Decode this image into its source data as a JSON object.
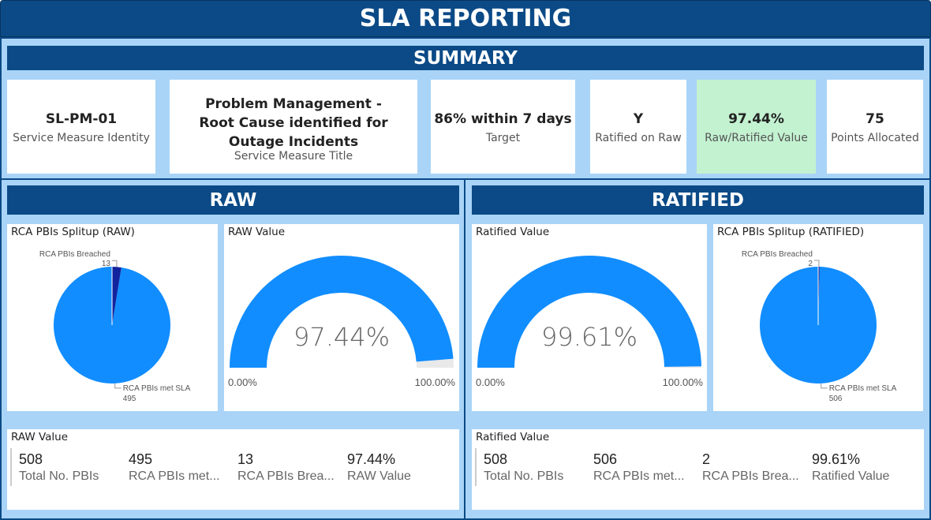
{
  "header": {
    "title": "SLA REPORTING"
  },
  "summary": {
    "heading": "SUMMARY",
    "cards": [
      {
        "value": "SL-PM-01",
        "label": "Service Measure Identity"
      },
      {
        "value": "Problem Management - Root Cause identified for Outage Incidents",
        "label": "Service Measure Title"
      },
      {
        "value": "86% within 7 days",
        "label": "Target"
      },
      {
        "value": "Y",
        "label": "Ratified on Raw"
      },
      {
        "value": "97.44%",
        "label": "Raw/Ratified Value"
      },
      {
        "value": "75",
        "label": "Points Allocated"
      }
    ]
  },
  "colors": {
    "brand": "#0b4a86",
    "frame": "#a9d4f7",
    "pie_main": "#118dff",
    "pie_breach": "#12239e",
    "gauge_bg": "#e9e9e9",
    "highlight": "#c3f2d1"
  },
  "raw": {
    "heading": "RAW",
    "pie_title": "RCA PBIs Splitup (RAW)",
    "gauge_title": "RAW Value",
    "gauge_value": "97.44%",
    "gauge_min": "0.00%",
    "gauge_max": "100.00%",
    "stats_title": "RAW Value",
    "stats": [
      {
        "value": "508",
        "label": "Total No. PBIs"
      },
      {
        "value": "495",
        "label": "RCA PBIs met..."
      },
      {
        "value": "13",
        "label": "RCA PBIs Brea..."
      },
      {
        "value": "97.44%",
        "label": "RAW Value"
      }
    ]
  },
  "ratified": {
    "heading": "RATIFIED",
    "pie_title": "RCA PBIs Splitup (RATIFIED)",
    "gauge_title": "Ratified Value",
    "gauge_value": "99.61%",
    "gauge_min": "0.00%",
    "gauge_max": "100.00%",
    "stats_title": "Ratified Value",
    "stats": [
      {
        "value": "508",
        "label": "Total No. PBIs"
      },
      {
        "value": "506",
        "label": "RCA PBIs met..."
      },
      {
        "value": "2",
        "label": "RCA PBIs Brea..."
      },
      {
        "value": "99.61%",
        "label": "Ratified Value"
      }
    ]
  },
  "chart_data": [
    {
      "type": "pie",
      "title": "RCA PBIs Splitup (RAW)",
      "categories": [
        "RCA PBIs met SLA",
        "RCA PBIs Breached"
      ],
      "values": [
        495,
        13
      ]
    },
    {
      "type": "gauge",
      "title": "RAW Value",
      "value": 97.44,
      "min": 0,
      "max": 100
    },
    {
      "type": "gauge",
      "title": "Ratified Value",
      "value": 99.61,
      "min": 0,
      "max": 100
    },
    {
      "type": "pie",
      "title": "RCA PBIs Splitup (RATIFIED)",
      "categories": [
        "RCA PBIs met SLA",
        "RCA PBIs Breached"
      ],
      "values": [
        506,
        2
      ]
    }
  ]
}
